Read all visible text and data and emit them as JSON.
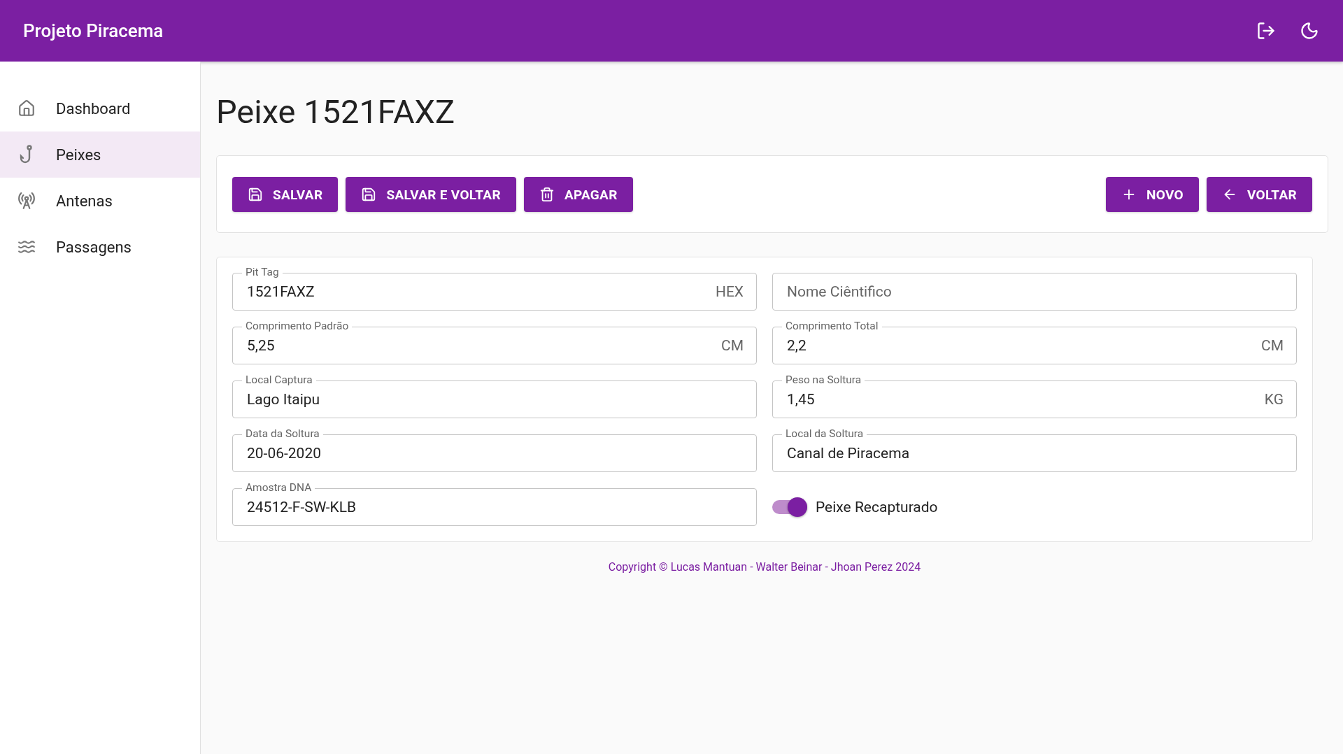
{
  "app_bar": {
    "title": "Projeto Piracema"
  },
  "sidebar": {
    "items": [
      {
        "label": "Dashboard",
        "selected": false
      },
      {
        "label": "Peixes",
        "selected": true
      },
      {
        "label": "Antenas",
        "selected": false
      },
      {
        "label": "Passagens",
        "selected": false
      }
    ]
  },
  "page_title": "Peixe 1521FAXZ",
  "toolbar": {
    "left_buttons": [
      {
        "label": "SALVAR"
      },
      {
        "label": "SALVAR E VOLTAR"
      },
      {
        "label": "APAGAR"
      }
    ],
    "right_buttons": [
      {
        "label": "NOVO"
      },
      {
        "label": "VOLTAR"
      }
    ]
  },
  "form": {
    "fields": [
      {
        "label": "Pit Tag",
        "value": "1521FAXZ",
        "unit": "HEX"
      },
      {
        "placeholder": "Nome Ciêntifico"
      },
      {
        "label": "Comprimento Padrão",
        "value": "5,25",
        "unit": "CM"
      },
      {
        "label": "Comprimento Total",
        "value": "2,2",
        "unit": "CM"
      },
      {
        "label": "Local Captura",
        "value": "Lago Itaipu"
      },
      {
        "label": "Peso na Soltura",
        "value": "1,45",
        "unit": "KG"
      },
      {
        "label": "Data da Soltura",
        "value": "20-06-2020"
      },
      {
        "label": "Local da Soltura",
        "value": "Canal de Piracema"
      },
      {
        "label": "Amostra DNA",
        "value": "24512-F-SW-KLB"
      }
    ],
    "switch": {
      "label": "Peixe Recapturado",
      "on": true
    }
  },
  "footer": "Copyright © Lucas Mantuan - Walter Beinar - Jhoan Perez 2024"
}
